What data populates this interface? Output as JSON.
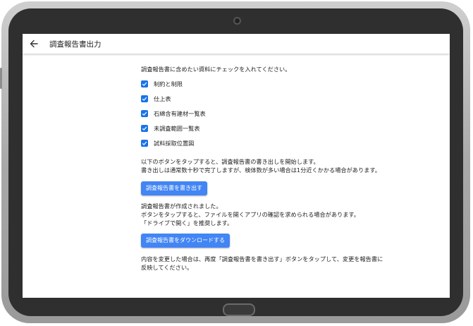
{
  "app_bar": {
    "title": "調査報告書出力"
  },
  "intro": "調査報告書に含めたい資料にチェックを入れてください。",
  "checkboxes": [
    {
      "label": "制約と制限",
      "checked": true
    },
    {
      "label": "仕上表",
      "checked": true
    },
    {
      "label": "石綿含有建材一覧表",
      "checked": true
    },
    {
      "label": "未調査範囲一覧表",
      "checked": true
    },
    {
      "label": "試料採取位置図",
      "checked": true
    }
  ],
  "export_text": {
    "line1": "以下のボタンをタップすると、調査報告書の書き出しを開始します。",
    "line2": "書き出しは通常数十秒で完了しますが、検体数が多い場合は1分近くかかる場合があります。"
  },
  "export_button": "調査報告書を書き出す",
  "created_text": {
    "line1": "調査報告書が作成されました。",
    "line2": "ボタンをタップすると、ファイルを開くアプリの確認を求められる場合があります。",
    "line3": "「ドライブで開く」を推奨します。"
  },
  "download_button": "調査報告書をダウンロードする",
  "changed_text": {
    "line1": "内容を変更した場合は、再度「調査報告書を書き出す」ボタンをタップして、変更を報告書に",
    "line2": "反映してください。"
  },
  "colors": {
    "accent": "#4285f4",
    "checkbox": "#1a73e8",
    "device_frame": "#a9a9a9"
  }
}
